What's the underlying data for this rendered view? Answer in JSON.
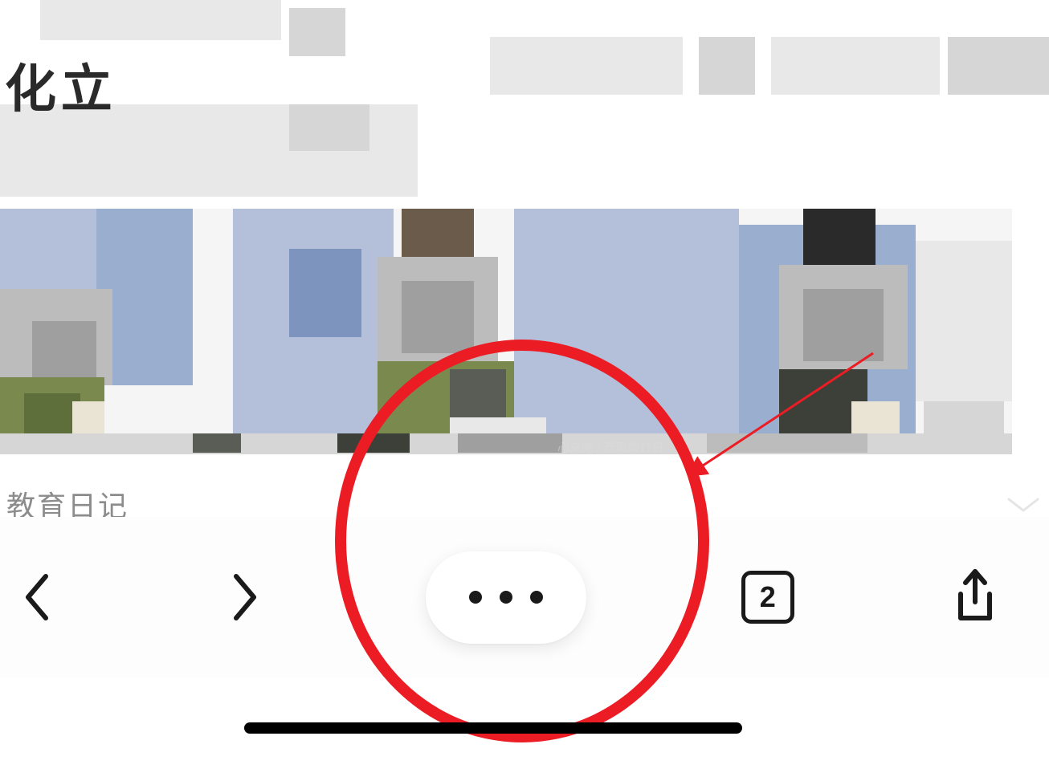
{
  "page_title_fragment": "化 立",
  "photo_watermark": "心来吧 / 西思教打日",
  "caption": "教育日记",
  "toolbar": {
    "back_label": "Back",
    "forward_label": "Forward",
    "menu_label": "More",
    "tabs_count": "2",
    "share_label": "Share"
  },
  "colors": {
    "annotation_red": "#ec1c24",
    "toolbar_bg": "#fdfdfd"
  }
}
